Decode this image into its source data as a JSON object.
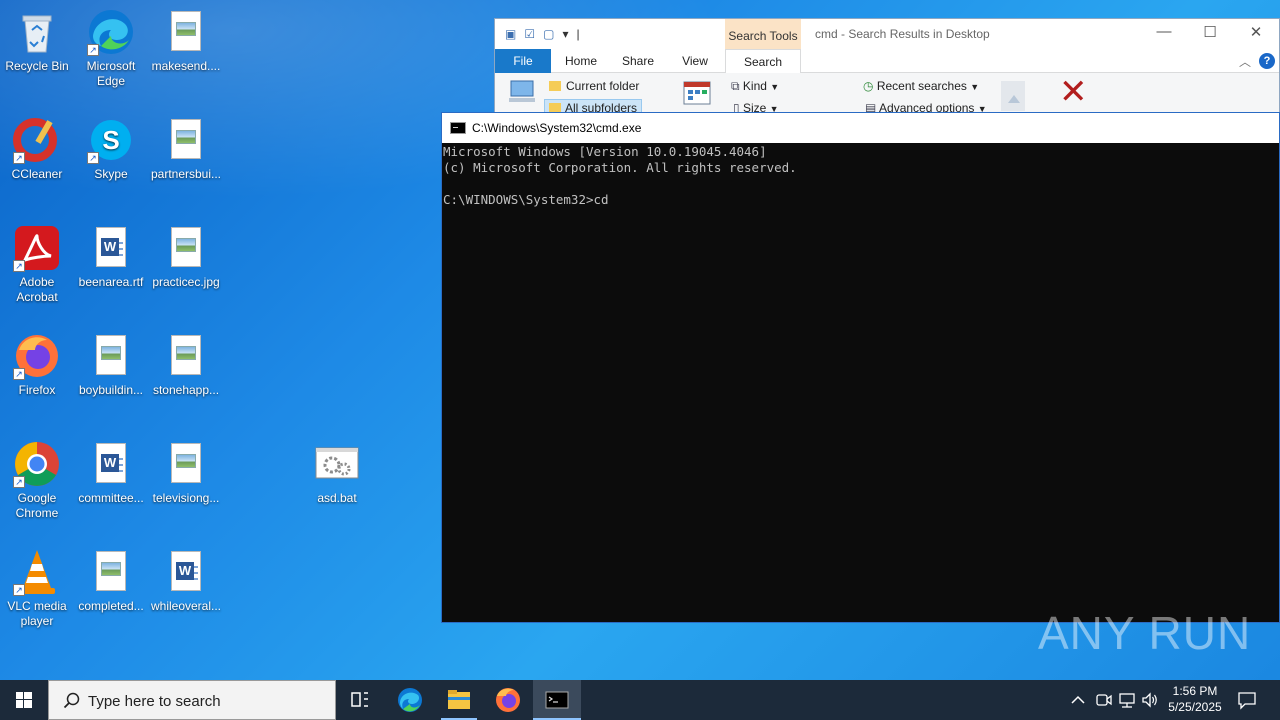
{
  "desktop": {
    "icons": [
      {
        "label": "Recycle Bin"
      },
      {
        "label": "Microsoft Edge"
      },
      {
        "label": "makesend...."
      },
      {
        "label": "CCleaner"
      },
      {
        "label": "Skype"
      },
      {
        "label": "partnersbui..."
      },
      {
        "label": "Adobe Acrobat"
      },
      {
        "label": "beenarea.rtf"
      },
      {
        "label": "practicec.jpg"
      },
      {
        "label": "Firefox"
      },
      {
        "label": "boybuildin..."
      },
      {
        "label": "stonehapp..."
      },
      {
        "label": "Google Chrome"
      },
      {
        "label": "committee..."
      },
      {
        "label": "televisiong..."
      },
      {
        "label": "asd.bat"
      },
      {
        "label": "VLC media player"
      },
      {
        "label": "completed..."
      },
      {
        "label": "whileoveral..."
      }
    ]
  },
  "explorer": {
    "title": "cmd - Search Results in Desktop",
    "search_tools_label": "Search Tools",
    "tabs": {
      "file": "File",
      "home": "Home",
      "share": "Share",
      "view": "View",
      "search": "Search"
    },
    "ribbon": {
      "current_folder": "Current folder",
      "all_subfolders": "All subfolders",
      "kind": "Kind",
      "size": "Size",
      "recent_searches": "Recent searches",
      "advanced_options": "Advanced options"
    }
  },
  "cmd": {
    "title": "C:\\Windows\\System32\\cmd.exe",
    "lines": [
      "Microsoft Windows [Version 10.0.19045.4046]",
      "(c) Microsoft Corporation. All rights reserved.",
      "",
      "C:\\WINDOWS\\System32>cd"
    ]
  },
  "watermark": "ANY RUN",
  "taskbar": {
    "search_placeholder": "Type here to search",
    "time": "1:56 PM",
    "date": "5/25/2025"
  },
  "colors": {
    "accent": "#1979ca",
    "desktop": "#1e8ae6",
    "taskbar": "#1c2a3a"
  }
}
